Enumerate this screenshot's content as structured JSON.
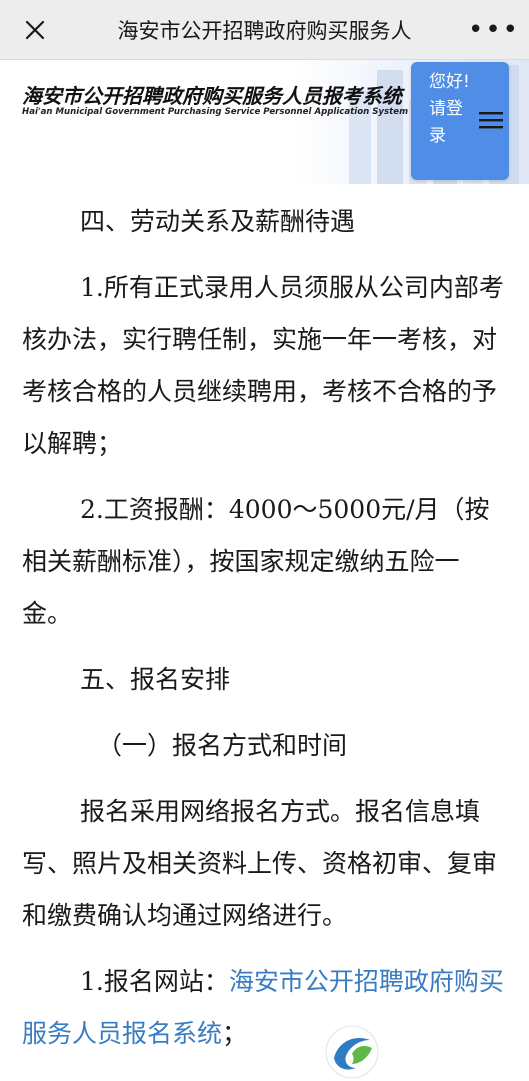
{
  "topbar": {
    "title": "海安市公开招聘政府购买服务人",
    "more": "•••"
  },
  "banner": {
    "brand_cn": "海安市公开招聘政府购买服务人员报考系统",
    "brand_en": "Hai'an Municipal Government Purchasing Service Personnel Application System",
    "login_text": "您好! 请登录"
  },
  "content": {
    "section4_title": "四、劳动关系及薪酬待遇",
    "section4_item1": "1.所有正式录用人员须服从公司内部考核办法，实行聘任制，实施一年一考核，对考核合格的人员继续聘用，考核不合格的予以解聘；",
    "section4_item2": "2.工资报酬：4000～5000元/月（按相关薪酬标准），按国家规定缴纳五险一金。",
    "section5_title": "五、报名安排",
    "section5_sub1": "（一）报名方式和时间",
    "section5_para": "报名采用网络报名方式。报名信息填写、照片及相关资料上传、资格初审、复审和缴费确认均通过网络进行。",
    "item1_label": "1.报名网站：",
    "item1_link": "海安市公开招聘政府购买服务人员报名系统",
    "item1_tail": "；"
  },
  "colors": {
    "link": "#3a7cc2",
    "login_bg": "#4f8de6"
  }
}
